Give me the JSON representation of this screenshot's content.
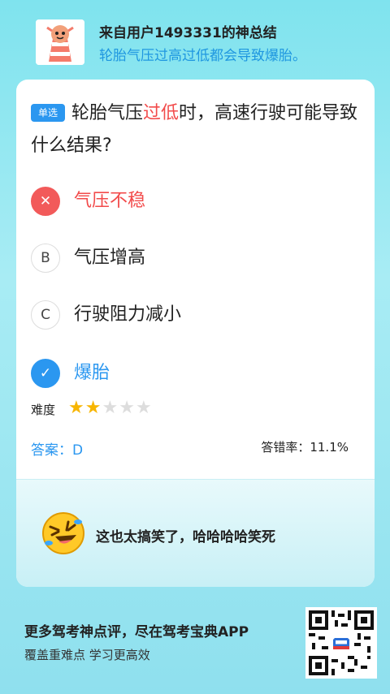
{
  "header": {
    "title": "来自用户1493331的神总结",
    "subtitle": "轮胎气压过高过低都会导致爆胎。"
  },
  "question": {
    "type_badge": "单选",
    "text_before": "轮胎气压",
    "text_highlight": "过低",
    "text_after": "时，高速行驶可能导致什么结果?"
  },
  "options": [
    {
      "marker": "✕",
      "label": "气压不稳",
      "state": "wrong"
    },
    {
      "marker": "B",
      "label": "气压增高",
      "state": "normal"
    },
    {
      "marker": "C",
      "label": "行驶阻力减小",
      "state": "normal"
    },
    {
      "marker": "✓",
      "label": "爆胎",
      "state": "right"
    }
  ],
  "difficulty": {
    "label": "难度",
    "rating": 2,
    "max": 5
  },
  "answer": {
    "label": "答案：D"
  },
  "error_rate": {
    "label": "答错率：11.1%"
  },
  "comment": {
    "text": "这也太搞笑了，哈哈哈哈笑死"
  },
  "footer": {
    "title": "更多驾考神点评，尽在驾考宝典APP",
    "subtitle": "覆盖重难点 学习更高效"
  },
  "colors": {
    "accent": "#2b97f0",
    "wrong": "#f24b4b",
    "star": "#f7b500"
  }
}
